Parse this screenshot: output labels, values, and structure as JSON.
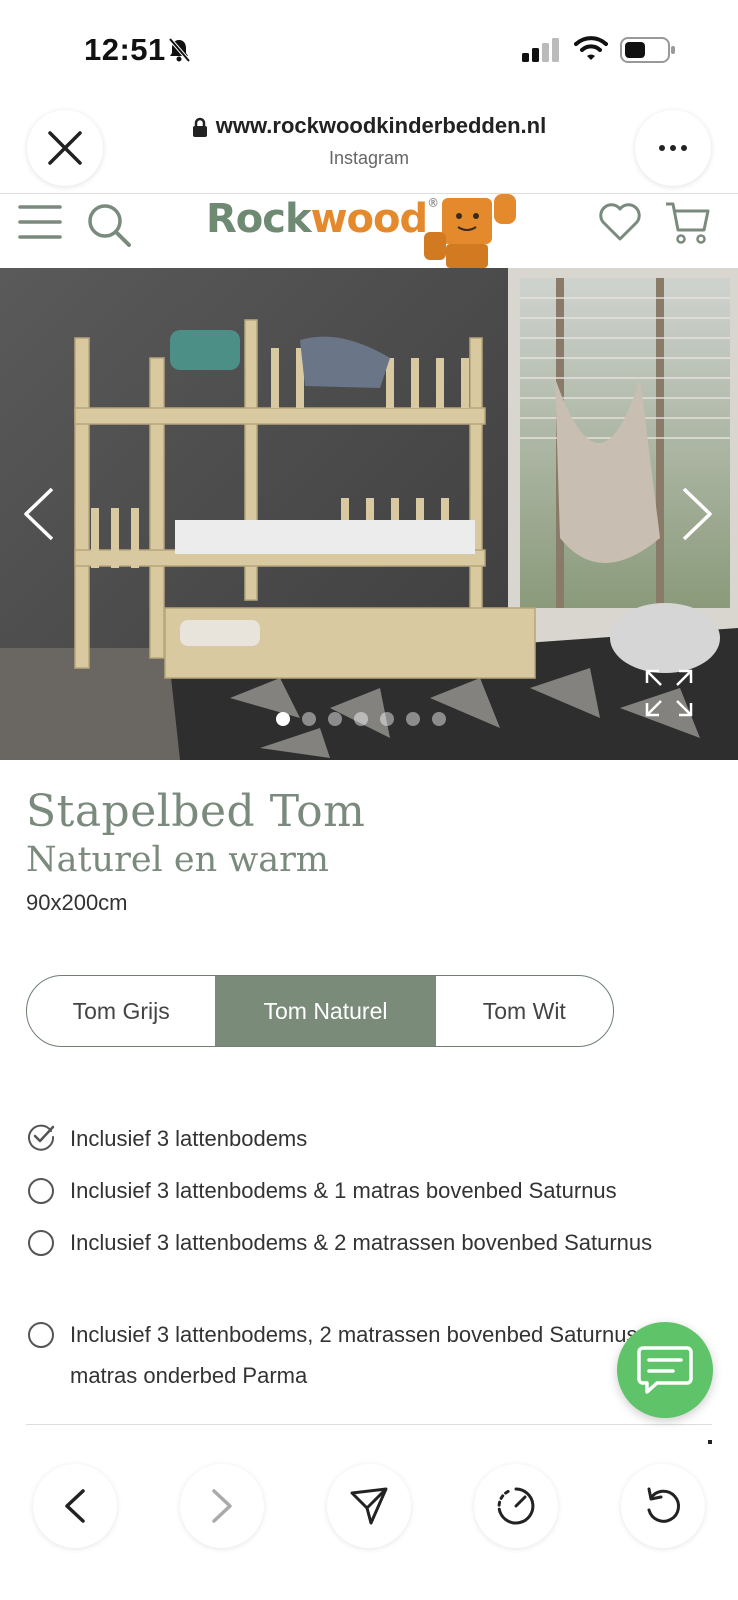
{
  "status_bar": {
    "time": "12:51",
    "icons": [
      "bell-slash-icon",
      "cellular-signal-icon",
      "wifi-icon",
      "battery-icon"
    ]
  },
  "browser": {
    "url": "www.rockwoodkinderbedden.nl",
    "source": "Instagram",
    "close_icon": "close-icon",
    "more_icon": "more-icon"
  },
  "site_nav": {
    "logo_part1": "Rock",
    "logo_part2": "wood",
    "logo_reg": "®",
    "icons": [
      "menu-icon",
      "search-icon",
      "heart-icon",
      "cart-icon"
    ],
    "brand_colors": {
      "green": "#6e8a72",
      "orange": "#e58a2c"
    }
  },
  "gallery": {
    "slide_count": 7,
    "active_index": 0
  },
  "product": {
    "title": "Stapelbed Tom",
    "subtitle": "Naturel en warm",
    "size": "90x200cm",
    "accent_color": "#7a8b7a"
  },
  "variants": {
    "items": [
      {
        "label": "Tom Grijs",
        "selected": false
      },
      {
        "label": "Tom Naturel",
        "selected": true
      },
      {
        "label": "Tom Wit",
        "selected": false
      }
    ]
  },
  "options": {
    "items": [
      {
        "label": "Inclusief 3 lattenbodems",
        "selected": true
      },
      {
        "label": "Inclusief 3 lattenbodems & 1 matras bovenbed Saturnus",
        "selected": false
      },
      {
        "label": "Inclusief 3 lattenbodems & 2 matrassen bovenbed Saturnus",
        "selected": false
      },
      {
        "label": "Inclusief 3 lattenbodems, 2 matrassen bovenbed Saturnus & 1 matras onderbed Parma",
        "selected": false
      }
    ]
  },
  "chat": {
    "icon": "chat-icon",
    "color": "#5fc36a"
  },
  "toolbar": {
    "icons": [
      "back-icon",
      "forward-icon",
      "share-icon",
      "speed-icon",
      "reload-icon"
    ]
  }
}
